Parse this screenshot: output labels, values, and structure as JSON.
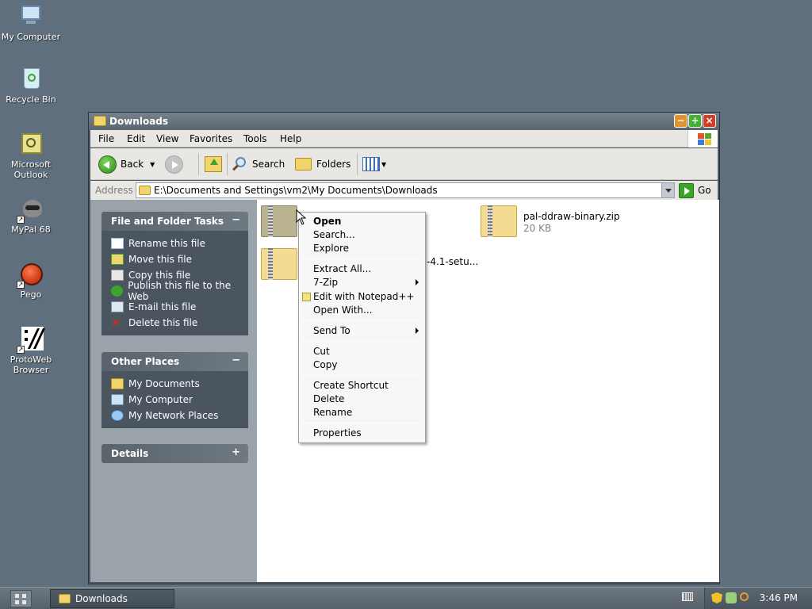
{
  "desktop": {
    "icons": [
      {
        "label": "My Computer",
        "icon": "computer-icon"
      },
      {
        "label": "Recycle Bin",
        "icon": "recycle-bin-icon"
      },
      {
        "label": "Microsoft Outlook",
        "icon": "outlook-icon"
      },
      {
        "label": "MyPal 68",
        "icon": "mypal-icon"
      },
      {
        "label": "Pego",
        "icon": "pego-icon"
      },
      {
        "label": "ProtoWeb Browser",
        "icon": "protoweb-icon"
      }
    ]
  },
  "window": {
    "title": "Downloads",
    "menu": [
      "File",
      "Edit",
      "View",
      "Favorites",
      "Tools",
      "Help"
    ],
    "toolbar": {
      "back": "Back",
      "search": "Search",
      "folders": "Folders"
    },
    "address": {
      "label": "Address",
      "value": "E:\\Documents and Settings\\vm2\\My Documents\\Downloads",
      "go": "Go"
    },
    "tasks_panel": {
      "title": "File and Folder Tasks",
      "toggle": "−",
      "items": [
        "Rename this file",
        "Move this file",
        "Copy this file",
        "Publish this file to the Web",
        "E-mail this file",
        "Delete this file"
      ]
    },
    "places_panel": {
      "title": "Other Places",
      "toggle": "−",
      "items": [
        "My Documents",
        "My Computer",
        "My Network Places"
      ]
    },
    "details_panel": {
      "title": "Details",
      "toggle": "+"
    },
    "files": [
      {
        "name": "",
        "selected": true
      },
      {
        "name": "pal-ddraw-binary.zip",
        "size": "20 KB"
      },
      {
        "name": "-4.1-setu...",
        "selected": false
      }
    ]
  },
  "context_menu": {
    "groups": [
      [
        "Open",
        "Search...",
        "Explore"
      ],
      [
        "Extract All...",
        "7-Zip",
        "Edit with Notepad++",
        "Open With..."
      ],
      [
        "Send To"
      ],
      [
        "Cut",
        "Copy"
      ],
      [
        "Create Shortcut",
        "Delete",
        "Rename"
      ],
      [
        "Properties"
      ]
    ]
  },
  "taskbar": {
    "task": "Downloads",
    "clock": "3:46 PM"
  },
  "colors": {
    "desktop": "#5f6f7d",
    "panel_body": "#4a5560",
    "left_pane": "#9aa2aa"
  }
}
